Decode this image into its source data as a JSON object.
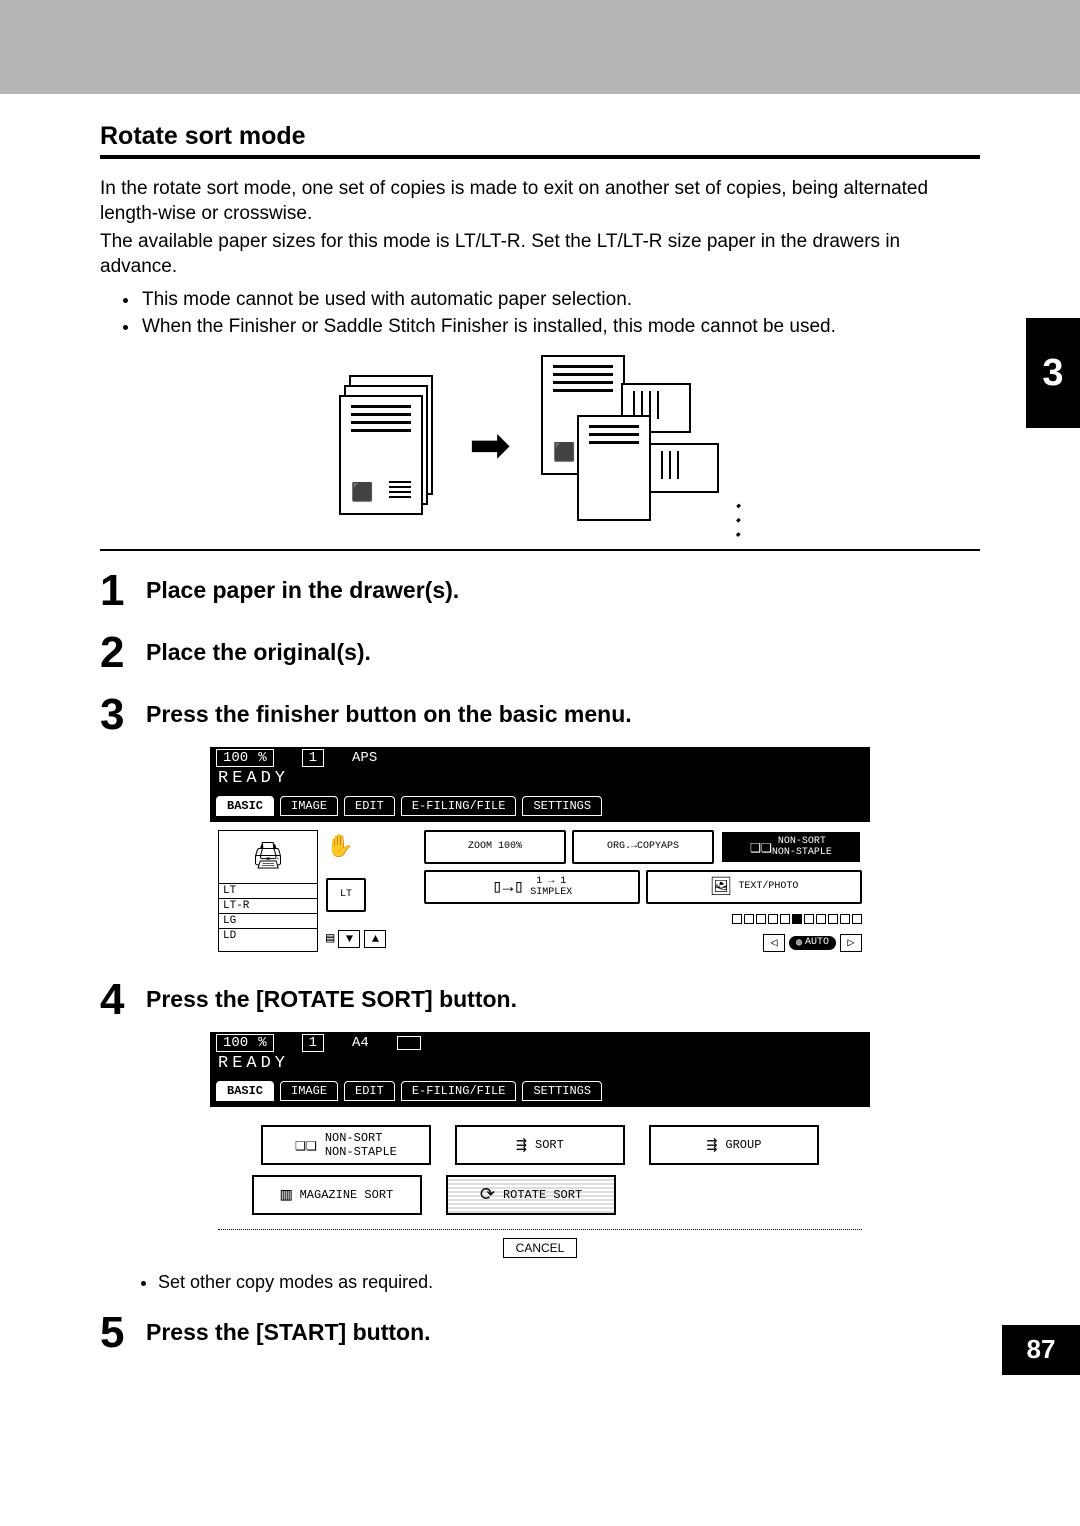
{
  "chapter_tab": "3",
  "page_number": "87",
  "section_title": "Rotate sort mode",
  "intro_p1": "In the rotate sort mode, one set of copies is made to exit on another set of copies, being alternated length-wise or crosswise.",
  "intro_p2": "The available paper sizes for this mode is LT/LT-R. Set the LT/LT-R size paper in the drawers in advance.",
  "notes": [
    "This mode cannot be used with automatic paper selection.",
    "When the Finisher or Saddle Stitch Finisher is installed, this mode cannot be used."
  ],
  "steps": [
    {
      "num": "1",
      "text": "Place paper in the drawer(s)."
    },
    {
      "num": "2",
      "text": "Place the original(s)."
    },
    {
      "num": "3",
      "text": "Press the finisher button on the basic menu."
    },
    {
      "num": "4",
      "text": "Press the [ROTATE SORT] button."
    },
    {
      "num": "5",
      "text": "Press the [START] button."
    }
  ],
  "step4_sub": "Set other copy modes as required.",
  "lcd_common": {
    "zoom_pct": "100",
    "pct_sym": "%",
    "copies": "1",
    "ready": "READY",
    "tabs": [
      "BASIC",
      "IMAGE",
      "EDIT",
      "E-FILING/FILE",
      "SETTINGS"
    ]
  },
  "lcd1": {
    "paper_label": "APS",
    "trays": [
      "",
      "LT",
      "LT-R",
      "LG",
      "LD"
    ],
    "tray_side": "LT",
    "zoom_label": "ZOOM",
    "zoom_val": "100%",
    "org_label": "ORG.→COPY",
    "org_val": "APS",
    "sort_label": "NON-SORT\nNON-STAPLE",
    "simplex_top": "1 → 1",
    "simplex": "SIMPLEX",
    "textphoto": "TEXT/PHOTO",
    "auto": "AUTO"
  },
  "lcd2": {
    "paper_label": "A4",
    "btns_row1": [
      "NON-SORT\nNON-STAPLE",
      "SORT",
      "GROUP"
    ],
    "btns_row2": [
      "MAGAZINE SORT",
      "ROTATE SORT"
    ],
    "cancel": "CANCEL"
  }
}
